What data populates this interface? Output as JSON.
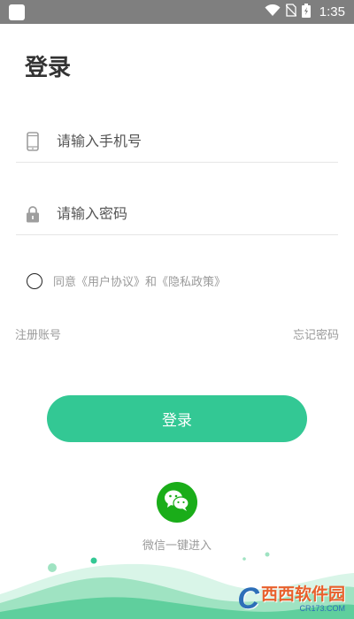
{
  "status_bar": {
    "time": "1:35"
  },
  "login": {
    "title": "登录",
    "phone": {
      "placeholder": "请输入手机号",
      "value": ""
    },
    "password": {
      "placeholder": "请输入密码",
      "value": ""
    },
    "agreement_text": "同意《用户协议》和《隐私政策》",
    "agreement_checked": false,
    "register_link": "注册账号",
    "forgot_link": "忘记密码",
    "submit_label": "登录",
    "wechat_label": "微信一键进入"
  },
  "watermark": {
    "name": "西西软件园",
    "url": "CR173.COM"
  },
  "colors": {
    "status_bar": "#7f7f7f",
    "primary": "#33c894",
    "wechat": "#1aad19",
    "hint_text": "#9a9a9a",
    "divider": "#e6e6e6",
    "wave_light": "#c9f0de",
    "wave_mid": "#6ed6a8"
  },
  "icons": {
    "status": [
      "app-icon",
      "wifi-icon",
      "no-sim-icon",
      "battery-charging-icon"
    ],
    "phone_field": "mobile-phone-icon",
    "password_field": "lock-icon",
    "wechat": "wechat-icon"
  }
}
